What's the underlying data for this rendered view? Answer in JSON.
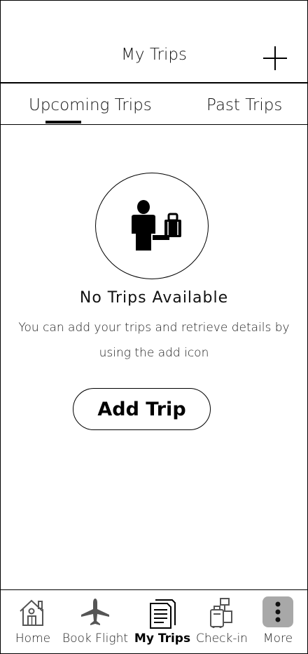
{
  "header": {
    "title": "My Trips",
    "add_icon": "plus-icon"
  },
  "tabs": [
    {
      "label": "Upcoming Trips",
      "active": true
    },
    {
      "label": "Past Trips",
      "active": false
    }
  ],
  "empty_state": {
    "icon": "traveler-with-luggage-icon",
    "title": "No Trips Available",
    "description": "You can add your trips and retrieve details by using the add icon",
    "button_label": "Add Trip"
  },
  "bottom_nav": {
    "items": [
      {
        "label": "Home",
        "icon": "home-icon",
        "active": false
      },
      {
        "label": "Book Flight",
        "icon": "airplane-icon",
        "active": false
      },
      {
        "label": "My Trips",
        "icon": "document-icon",
        "active": true
      },
      {
        "label": "Check-in",
        "icon": "check-in-icon",
        "active": false
      },
      {
        "label": "More",
        "icon": "more-vertical-icon",
        "active": false
      }
    ]
  },
  "colors": {
    "foreground": "#000000",
    "background": "#ffffff",
    "more_highlight": "#a8a8a8"
  }
}
